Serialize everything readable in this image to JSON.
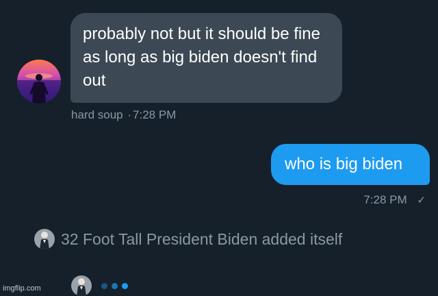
{
  "conversation": {
    "incoming_message": {
      "text": "probably not but it should be fine as long as big biden doesn't find out",
      "sender": "hard soup",
      "separator": "·",
      "time": "7:28 PM"
    },
    "outgoing_message": {
      "text": "who is big biden",
      "time": "7:28 PM",
      "status_icon": "check-icon",
      "status_glyph": "✓"
    },
    "system_event": {
      "text": "32 Foot Tall President Biden added itself"
    },
    "typing_indicator": {
      "dot_count": 3
    }
  },
  "watermark": {
    "text": "imgflip.com"
  },
  "colors": {
    "background": "#15202b",
    "incoming_bubble": "#3c4954",
    "outgoing_bubble": "#1d9bf0",
    "meta_text": "#8b98a5",
    "typing_dots": "#1d9bf0"
  }
}
